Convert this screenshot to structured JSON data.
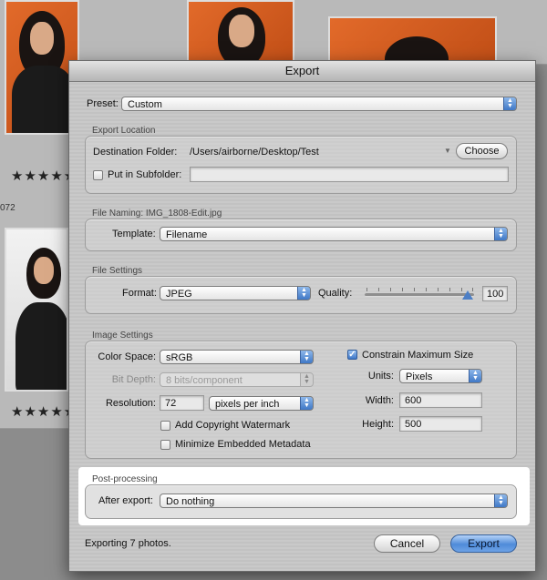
{
  "background": {
    "rating_stars": "★★★★★",
    "photo_number": "072"
  },
  "dialog": {
    "title": "Export",
    "preset": {
      "label": "Preset:",
      "value": "Custom"
    },
    "export_location": {
      "group_title": "Export Location",
      "destination_label": "Destination Folder:",
      "destination_path": "/Users/airborne/Desktop/Test",
      "choose_button": "Choose",
      "subfolder_label": "Put in Subfolder:",
      "subfolder_value": ""
    },
    "file_naming": {
      "group_title": "File Naming:  IMG_1808-Edit.jpg",
      "template_label": "Template:",
      "template_value": "Filename"
    },
    "file_settings": {
      "group_title": "File Settings",
      "format_label": "Format:",
      "format_value": "JPEG",
      "quality_label": "Quality:",
      "quality_value": "100"
    },
    "image_settings": {
      "group_title": "Image Settings",
      "color_space_label": "Color Space:",
      "color_space_value": "sRGB",
      "bit_depth_label": "Bit Depth:",
      "bit_depth_value": "8 bits/component",
      "resolution_label": "Resolution:",
      "resolution_value": "72",
      "resolution_unit": "pixels per inch",
      "copyright_label": "Add Copyright Watermark",
      "metadata_label": "Minimize Embedded Metadata",
      "constrain_label": "Constrain Maximum Size",
      "units_label": "Units:",
      "units_value": "Pixels",
      "width_label": "Width:",
      "width_value": "600",
      "height_label": "Height:",
      "height_value": "500"
    },
    "post_processing": {
      "group_title": "Post-processing",
      "after_export_label": "After export:",
      "after_export_value": "Do nothing"
    },
    "footer": {
      "status": "Exporting 7 photos.",
      "cancel_button": "Cancel",
      "export_button": "Export"
    }
  }
}
